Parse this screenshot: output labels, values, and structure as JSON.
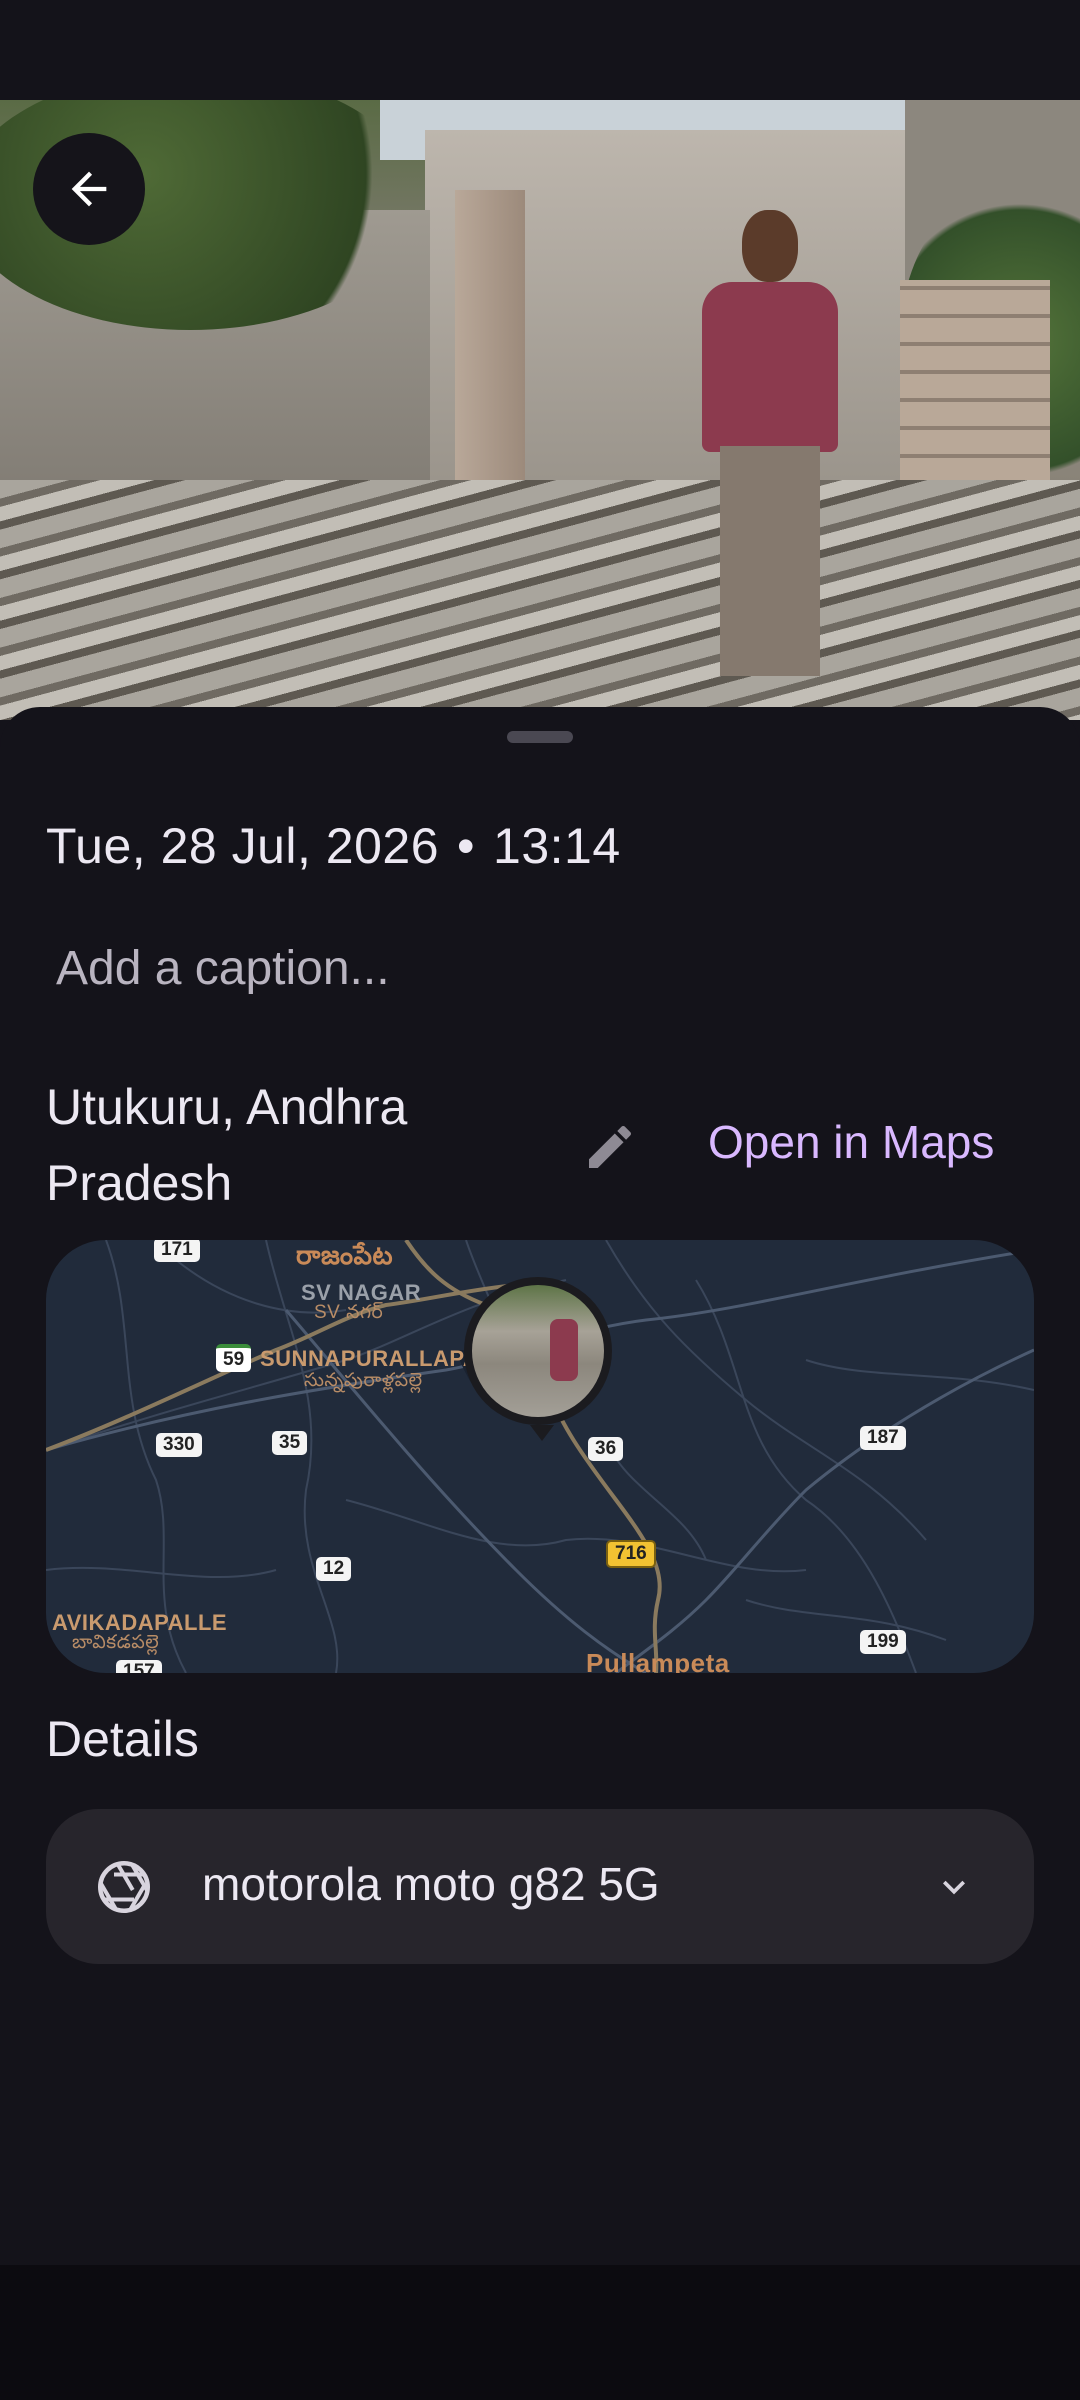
{
  "photo": {
    "alt": "Photo"
  },
  "back_button": {
    "icon": "arrow-back-icon"
  },
  "info": {
    "date": "Tue, 28 Jul, 2026",
    "separator": "•",
    "time": "13:14",
    "caption_placeholder": "Add a caption...",
    "location": "Utukuru, Andhra Pradesh",
    "edit_icon": "pencil-icon",
    "open_in_maps": "Open in Maps"
  },
  "map": {
    "places": {
      "rajampet": "రాజంపేట",
      "sv_nagar": "SV NAGAR",
      "sv_nagar_te": "SV నగర్",
      "sunnapurallapalle": "SUNNAPURALLAPALLE",
      "sunnapurallapalle_te": "సున్నపురాళ్లపల్లె",
      "avikadapalle": "AVIKADAPALLE",
      "avikadapalle_te": "బావికడపల్లె",
      "pullampeta": "Pullampeta"
    },
    "road_numbers": {
      "r171": "171",
      "r59": "59",
      "r330": "330",
      "r35": "35",
      "r36": "36",
      "r187": "187",
      "r716": "716",
      "r12": "12",
      "r199": "199",
      "r157": "157"
    }
  },
  "details": {
    "title": "Details",
    "device": "motorola moto g82 5G",
    "device_icon": "camera-aperture-icon",
    "expand_icon": "chevron-down-icon"
  }
}
